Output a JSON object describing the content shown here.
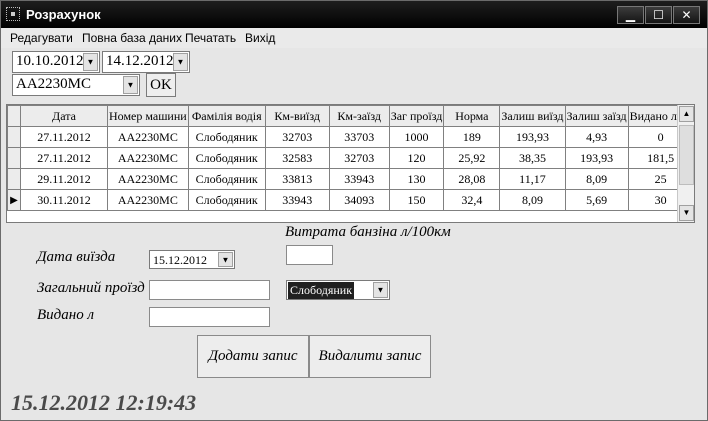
{
  "window": {
    "title": "Розрахунок",
    "min_glyph": "▁",
    "max_glyph": "☐",
    "close_glyph": "✕"
  },
  "menu": [
    "Редагувати",
    "Повна база даних",
    "Печатать",
    "Вихід"
  ],
  "filters": {
    "date_from": "10.10.2012",
    "date_to": "14.12.2012",
    "car": "АА2230МС",
    "ok_label": "OK",
    "dropdown_glyph": "▼"
  },
  "grid": {
    "columns": [
      "Дата",
      "Номер машини",
      "Фамілія водія",
      "Км-виїзд",
      "Км-заїзд",
      "Заг проїзд",
      "Норма",
      "Залиш виїзд",
      "Залиш заїзд",
      "Видано літр"
    ],
    "rows": [
      [
        "27.11.2012",
        "АА2230МС",
        "Слободяник",
        "32703",
        "33703",
        "1000",
        "189",
        "193,93",
        "4,93",
        "0"
      ],
      [
        "27.11.2012",
        "АА2230МС",
        "Слободяник",
        "32583",
        "32703",
        "120",
        "25,92",
        "38,35",
        "193,93",
        "181,5"
      ],
      [
        "29.11.2012",
        "АА2230МС",
        "Слободяник",
        "33813",
        "33943",
        "130",
        "28,08",
        "11,17",
        "8,09",
        "25"
      ],
      [
        "30.11.2012",
        "АА2230МС",
        "Слободяник",
        "33943",
        "34093",
        "150",
        "32,4",
        "8,09",
        "5,69",
        "30"
      ]
    ],
    "current_row_marker": "▶",
    "scroll_up": "▲",
    "scroll_down": "▼"
  },
  "form": {
    "consumption_label": "Витрата банзіна л/100км",
    "consumption_value": "",
    "departure_label": "Дата виїзда",
    "departure_date": "15.12.2012",
    "distance_label": "Загальний проїзд",
    "distance_value": "",
    "driver": "Слободяник",
    "issued_label": "Видано л",
    "issued_value": "",
    "add_button": "Додати запис",
    "delete_button": "Видалити запис"
  },
  "clock": "15.12.2012 12:19:43"
}
